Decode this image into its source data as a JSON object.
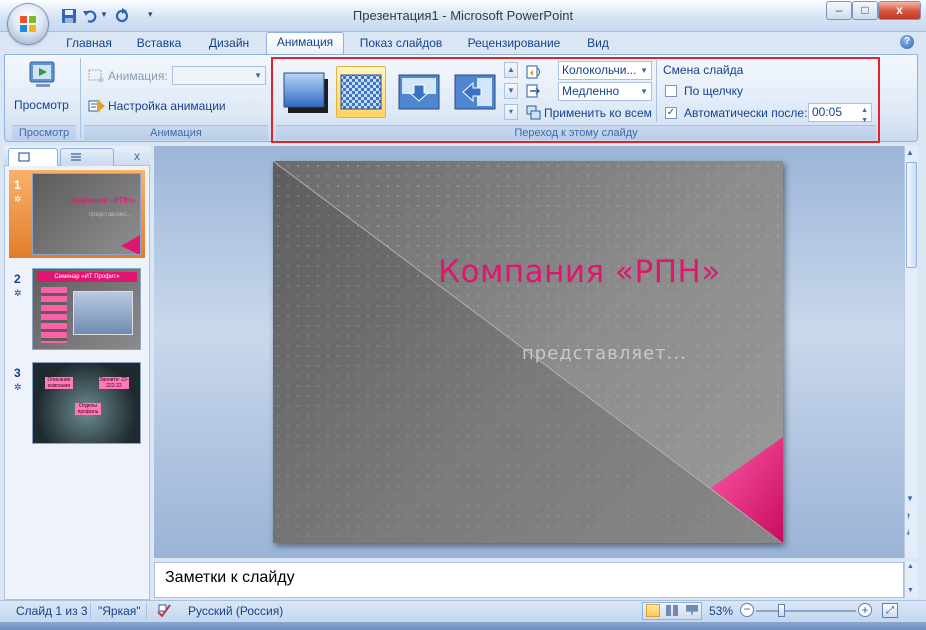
{
  "window": {
    "title": "Презентация1 - Microsoft PowerPoint",
    "min_label": "–",
    "max_label": "□",
    "close_label": "x"
  },
  "tabs": [
    {
      "label": "Главная"
    },
    {
      "label": "Вставка"
    },
    {
      "label": "Дизайн"
    },
    {
      "label": "Анимация",
      "active": true
    },
    {
      "label": "Показ слайдов"
    },
    {
      "label": "Рецензирование"
    },
    {
      "label": "Вид"
    }
  ],
  "help_label": "?",
  "ribbon": {
    "preview": {
      "button_label": "Просмотр",
      "group_label": "Просмотр"
    },
    "animation": {
      "animation_label": "Анимация:",
      "custom_label": "Настройка анимации",
      "group_label": "Анимация"
    },
    "transition": {
      "group_label": "Переход к этому слайду",
      "sound_value": "Колокольчи...",
      "speed_value": "Медленно",
      "apply_all_label": "Применить ко всем"
    },
    "advance": {
      "title": "Смена слайда",
      "on_click_label": "По щелчку",
      "on_click_checked": false,
      "auto_label": "Автоматически после:",
      "auto_checked": true,
      "auto_value": "00:05"
    }
  },
  "slides_panel": {
    "close_label": "x",
    "slides": [
      {
        "number": "1",
        "thumb_title": "Компания «РПН»",
        "thumb_sub": "представляет..."
      },
      {
        "number": "2",
        "thumb_title": "Семинар «ИТ Профит»"
      },
      {
        "number": "3",
        "thumb_box_a": "Описание компании",
        "thumb_box_b": "Звоните: 22-222-22",
        "thumb_box_c": "Отделы профиль"
      }
    ]
  },
  "slide": {
    "title": "Компания «РПН»",
    "subtitle": "представляет..."
  },
  "notes_placeholder": "Заметки к слайду",
  "status": {
    "slide_info": "Слайд 1 из 3",
    "theme": "\"Яркая\"",
    "language": "Русский (Россия)",
    "zoom": "53%"
  },
  "colors": {
    "accent": "#e0156f",
    "ribbon_text": "#15428b",
    "highlight_frame": "#e3232b"
  }
}
